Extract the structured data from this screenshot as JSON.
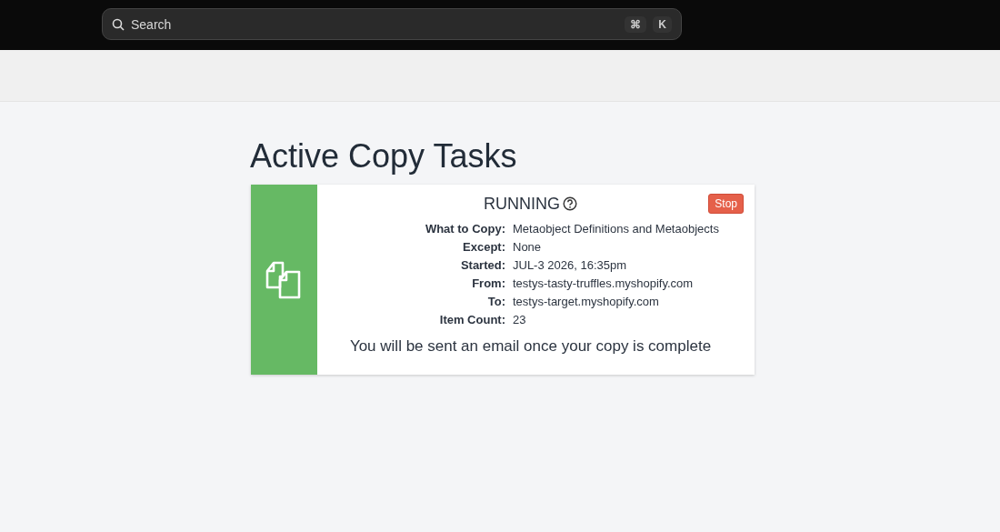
{
  "search": {
    "placeholder": "Search",
    "shortcut": [
      "⌘",
      "K"
    ]
  },
  "page": {
    "title": "Active Copy Tasks"
  },
  "tasks": [
    {
      "status": "RUNNING",
      "kind": "running",
      "stop_label": "Stop",
      "fields": [
        {
          "label": "What to Copy:",
          "value": "Metaobject Definitions and Metaobjects"
        },
        {
          "label": "Except:",
          "value": "None"
        },
        {
          "label": "Started:",
          "value": "JUL-3 2026, 16:35pm"
        },
        {
          "label": "From:",
          "value": "testys-tasty-truffles.myshopify.com"
        },
        {
          "label": "To:",
          "value": "testys-target.myshopify.com"
        },
        {
          "label": "Item Count:",
          "value": "23"
        }
      ],
      "note": "You will be sent an email once your copy is complete"
    }
  ]
}
